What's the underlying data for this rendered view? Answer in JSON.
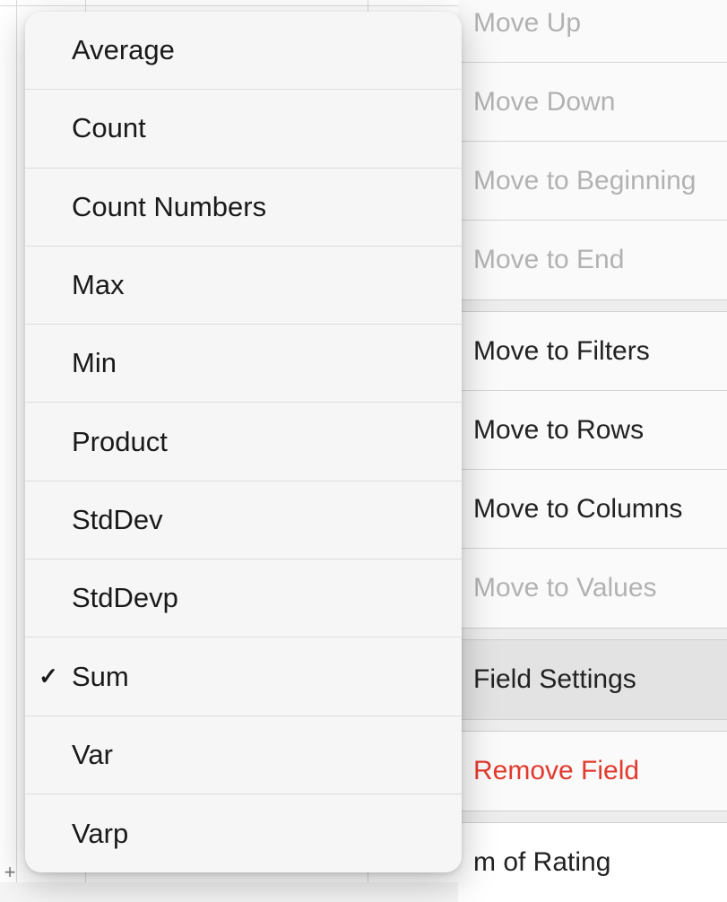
{
  "aggregation_functions": {
    "selected": "Sum",
    "items": [
      {
        "label": "Average",
        "checked": false
      },
      {
        "label": "Count",
        "checked": false
      },
      {
        "label": "Count Numbers",
        "checked": false
      },
      {
        "label": "Max",
        "checked": false
      },
      {
        "label": "Min",
        "checked": false
      },
      {
        "label": "Product",
        "checked": false
      },
      {
        "label": "StdDev",
        "checked": false
      },
      {
        "label": "StdDevp",
        "checked": false
      },
      {
        "label": "Sum",
        "checked": true
      },
      {
        "label": "Var",
        "checked": false
      },
      {
        "label": "Varp",
        "checked": false
      }
    ]
  },
  "field_menu": {
    "move_up": "Move Up",
    "move_down": "Move Down",
    "move_to_beginning": "Move to Beginning",
    "move_to_end": "Move to End",
    "move_to_filters": "Move to Filters",
    "move_to_rows": "Move to Rows",
    "move_to_columns": "Move to Columns",
    "move_to_values": "Move to Values",
    "field_settings": "Field Settings",
    "remove_field": "Remove Field",
    "partial_visible": "m of Rating"
  },
  "glyphs": {
    "check": "✓",
    "plus": "+"
  }
}
